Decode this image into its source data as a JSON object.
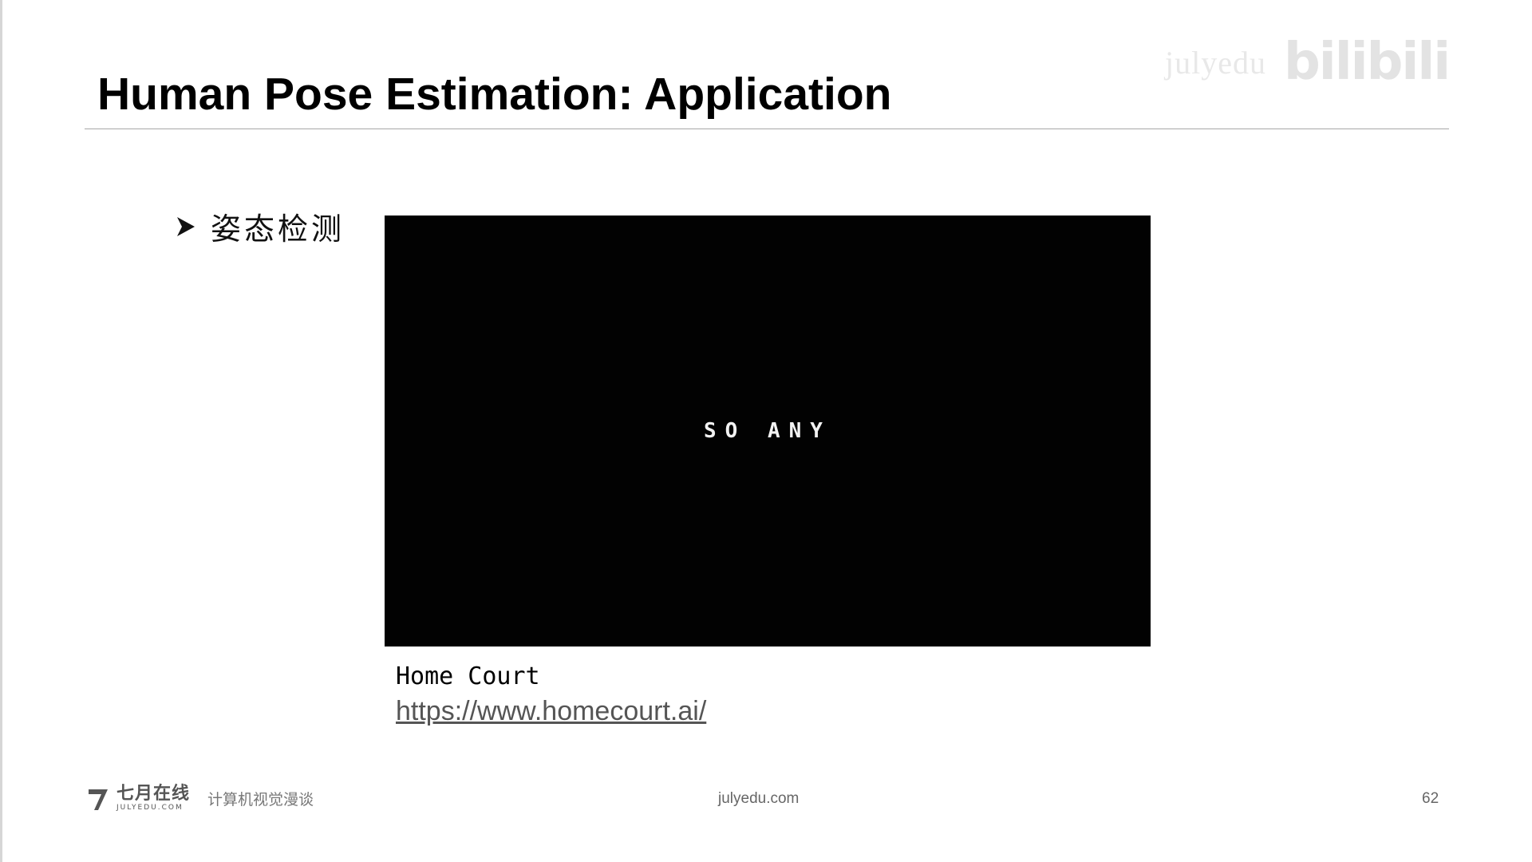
{
  "slide": {
    "title": "Human Pose Estimation: Application",
    "bullet": "姿态检测"
  },
  "video": {
    "overlay_text": "SO ANY"
  },
  "caption": {
    "name": "Home Court",
    "link": "https://www.homecourt.ai/"
  },
  "watermark": {
    "site": "julyedu",
    "logo": "bilibili"
  },
  "footer": {
    "brand_cn": "七月在线",
    "brand_en": "JULYEDU.COM",
    "course": "计算机视觉漫谈",
    "site": "julyedu.com",
    "page_number": "62"
  },
  "colors": {
    "background": "#ffffff",
    "video_background": "#020202",
    "title": "#000000",
    "footer_text": "#666666"
  }
}
